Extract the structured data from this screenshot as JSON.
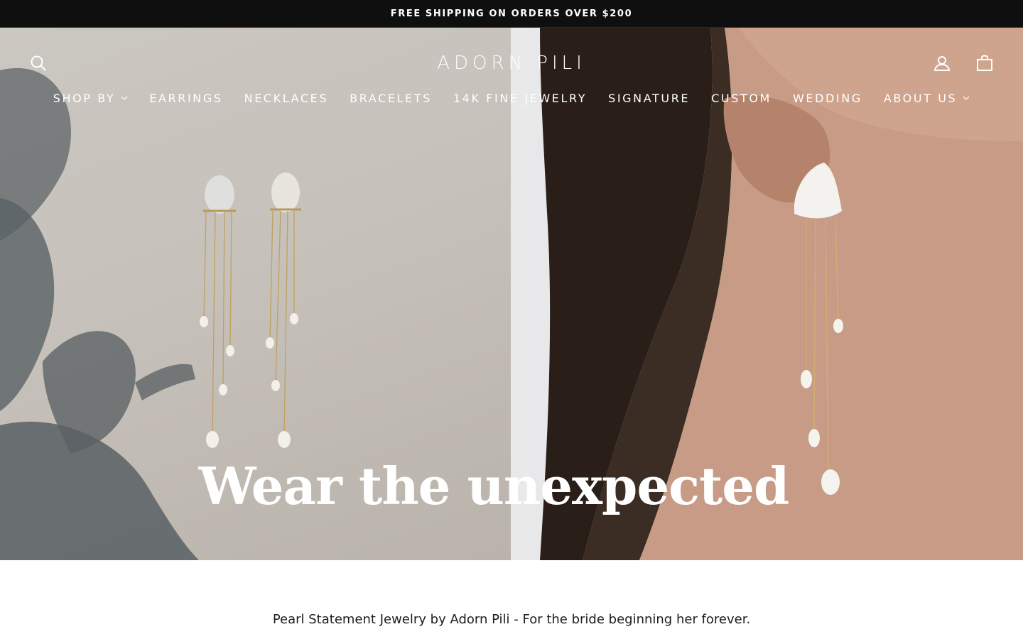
{
  "announcement": {
    "text": "FREE SHIPPING ON ORDERS OVER $200"
  },
  "header": {
    "logo": "ADORN PILI",
    "icons": {
      "search": "search-icon",
      "account": "user-icon",
      "cart": "bag-icon"
    }
  },
  "nav": {
    "items": [
      {
        "label": "SHOP BY",
        "dropdown": true
      },
      {
        "label": "EARRINGS",
        "dropdown": false
      },
      {
        "label": "NECKLACES",
        "dropdown": false
      },
      {
        "label": "BRACELETS",
        "dropdown": false
      },
      {
        "label": "14K FINE JEWELRY",
        "dropdown": false
      },
      {
        "label": "SIGNATURE",
        "dropdown": false
      },
      {
        "label": "CUSTOM",
        "dropdown": false
      },
      {
        "label": "WEDDING",
        "dropdown": false
      },
      {
        "label": "ABOUT US",
        "dropdown": true
      }
    ]
  },
  "hero": {
    "title": "Wear the unexpected"
  },
  "intro": {
    "tagline": "Pearl Statement Jewelry by Adorn Pili - For the bride beginning her forever."
  },
  "colors": {
    "announcement_bg": "#0f0f0f",
    "text_on_hero": "#ffffff",
    "body_text": "#1d1d1d"
  }
}
